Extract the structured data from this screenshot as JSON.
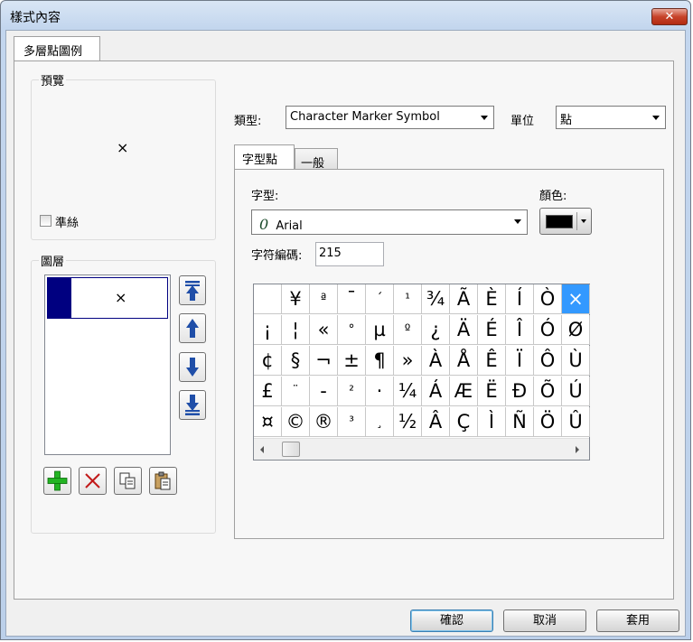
{
  "window": {
    "title": "樣式內容",
    "close_symbol": "✕"
  },
  "main_tab": {
    "label": "多層點圖例"
  },
  "preview": {
    "title": "預覽",
    "symbol": "×",
    "checkbox_label": "準絲"
  },
  "layers": {
    "title": "圖層",
    "items": [
      {
        "symbol": "×",
        "color": "#000080"
      }
    ]
  },
  "type_field": {
    "label": "類型:",
    "value": "Character Marker Symbol"
  },
  "unit_field": {
    "label": "單位",
    "value": "點"
  },
  "subtabs": [
    {
      "label": "字型點"
    },
    {
      "label": "一般"
    }
  ],
  "font_field": {
    "label": "字型:",
    "value": "Arial",
    "icon": "0"
  },
  "color_field": {
    "label": "顏色:",
    "value": "#000000"
  },
  "charcode_field": {
    "label": "字符編碼:",
    "value": "215"
  },
  "char_grid": {
    "rows": [
      [
        "",
        "¥",
        "ª",
        "¯",
        "´",
        "¹",
        "¾",
        "Ã",
        "È",
        "Í",
        "Ò",
        "×"
      ],
      [
        "¡",
        "¦",
        "«",
        "°",
        "µ",
        "º",
        "¿",
        "Ä",
        "É",
        "Î",
        "Ó",
        "Ø"
      ],
      [
        "¢",
        "§",
        "¬",
        "±",
        "¶",
        "»",
        "À",
        "Å",
        "Ê",
        "Ï",
        "Ô",
        "Ù"
      ],
      [
        "£",
        "¨",
        "-",
        "²",
        "·",
        "¼",
        "Á",
        "Æ",
        "Ë",
        "Ð",
        "Õ",
        "Ú"
      ],
      [
        "¤",
        "©",
        "®",
        "³",
        "¸",
        "½",
        "Â",
        "Ç",
        "Ì",
        "Ñ",
        "Ö",
        "Û"
      ]
    ],
    "selected": "×"
  },
  "buttons": {
    "ok": "確認",
    "cancel": "取消",
    "apply": "套用"
  }
}
